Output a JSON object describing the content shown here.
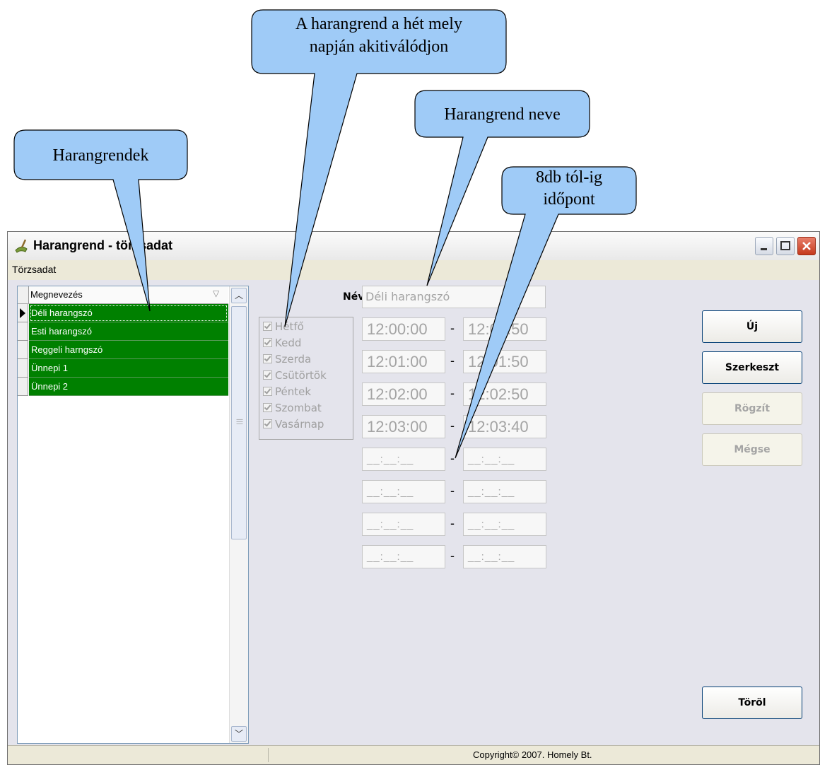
{
  "callouts": {
    "days_line1": "A harangrend a hét mely",
    "days_line2": "napján akitiválódjon",
    "name": "Harangrend neve",
    "list": "Harangrendek",
    "times_line1": "8db tól-ig",
    "times_line2": "időpont",
    "fill_color": "#9fcbf7"
  },
  "window": {
    "title": "Harangrend - törzsadat",
    "menu": "Törzsadat"
  },
  "grid": {
    "column_header": "Megnevezés",
    "rows": [
      "Déli harangszó",
      "Esti harangszó",
      "Reggeli harngszó",
      "Ünnepi 1",
      "Ünnepi 2"
    ],
    "row_color": "#008000"
  },
  "days": [
    "Hétfő",
    "Kedd",
    "Szerda",
    "Csütörtök",
    "Péntek",
    "Szombat",
    "Vasárnap"
  ],
  "form": {
    "nev_label": "Név:",
    "nev_value": "Déli harangszó",
    "separator": "-",
    "times": [
      {
        "from": "12:00:00",
        "to": "12:00:50"
      },
      {
        "from": "12:01:00",
        "to": "12:01:50"
      },
      {
        "from": "12:02:00",
        "to": "12:02:50"
      },
      {
        "from": "12:03:00",
        "to": "12:03:40"
      },
      {
        "from": "__:__:__",
        "to": "__:__:__"
      },
      {
        "from": "__:__:__",
        "to": "__:__:__"
      },
      {
        "from": "__:__:__",
        "to": "__:__:__"
      },
      {
        "from": "__:__:__",
        "to": "__:__:__"
      }
    ]
  },
  "buttons": {
    "new": "Új",
    "edit": "Szerkeszt",
    "save": "Rögzít",
    "cancel": "Mégse",
    "delete": "Töröl"
  },
  "status": {
    "copyright": "Copyright© 2007. Homely Bt."
  }
}
